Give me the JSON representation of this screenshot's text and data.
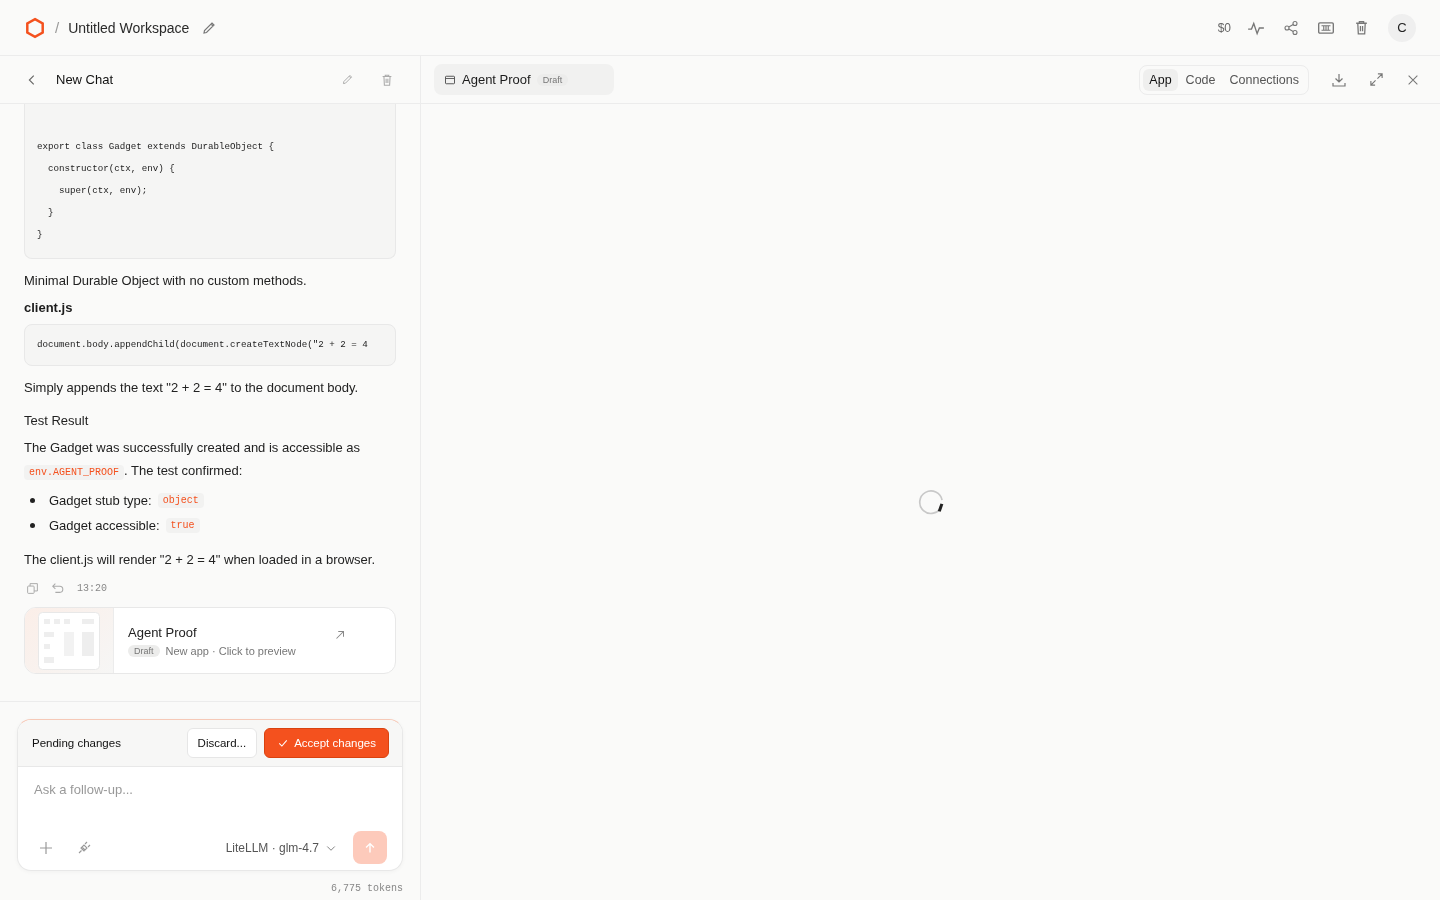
{
  "topbar": {
    "separator": "/",
    "workspace": "Untitled Workspace",
    "cost": "$0",
    "avatar": "C"
  },
  "chat": {
    "title": "New Chat",
    "blocks": [
      {
        "kind": "code",
        "lines": [
          "export class Gadget extends DurableObject {",
          "  constructor(ctx, env) {",
          "    super(ctx, env);",
          "  }",
          "}"
        ]
      },
      {
        "kind": "para",
        "text": "Minimal Durable Object with no custom methods."
      },
      {
        "kind": "file",
        "text": "client.js"
      },
      {
        "kind": "code",
        "lines": [
          "document.body.appendChild(document.createTextNode(\"2 + 2 = 4"
        ]
      },
      {
        "kind": "para",
        "text": "Simply appends the text \"2 + 2 = 4\" to the document body."
      },
      {
        "kind": "heading",
        "text": "Test Result"
      },
      {
        "kind": "rich",
        "parts": [
          {
            "t": "The Gadget was successfully created and is accessible as "
          },
          {
            "code": "env.AGENT_PROOF"
          },
          {
            "t": ". The test confirmed:"
          }
        ]
      },
      {
        "kind": "bullets",
        "items": [
          {
            "label": "Gadget stub type:",
            "code": "object"
          },
          {
            "label": "Gadget accessible:",
            "code": "true"
          }
        ]
      },
      {
        "kind": "para",
        "text": "The client.js will render \"2 + 2 = 4\" when loaded in a browser."
      }
    ],
    "time": "13:20",
    "card": {
      "title": "Agent Proof",
      "badge": "Draft",
      "subtitle": "New app · Click to preview"
    },
    "pending": {
      "label": "Pending changes",
      "discard": "Discard...",
      "accept": "Accept changes"
    },
    "input": {
      "placeholder": "Ask a follow-up...",
      "model": "LiteLLM · glm-4.7"
    },
    "tokens": "6,775 tokens"
  },
  "preview": {
    "title": "Agent Proof",
    "badge": "Draft",
    "tabs": [
      {
        "label": "App",
        "selected": true
      },
      {
        "label": "Code",
        "selected": false
      },
      {
        "label": "Connections",
        "selected": false
      }
    ]
  }
}
